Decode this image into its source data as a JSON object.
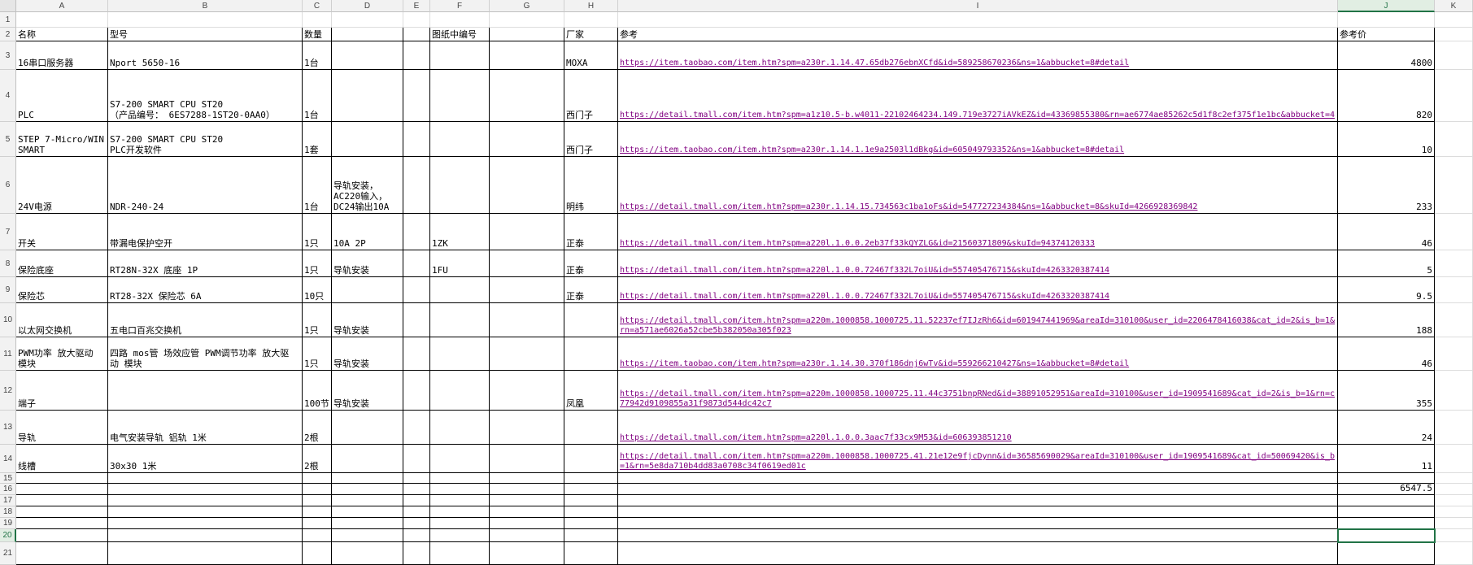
{
  "columns": [
    "A",
    "B",
    "C",
    "D",
    "E",
    "F",
    "G",
    "H",
    "I",
    "J",
    "K"
  ],
  "selected_column": "J",
  "selected_row": "20",
  "rows": [
    "1",
    "2",
    "3",
    "4",
    "5",
    "6",
    "7",
    "8",
    "9",
    "10",
    "11",
    "12",
    "13",
    "14",
    "15",
    "16",
    "17",
    "18",
    "19",
    "20",
    "21"
  ],
  "header_row": {
    "name": "名称",
    "model": "型号",
    "qty": "数量",
    "drawing_no": "图纸中编号",
    "vendor": "厂家",
    "reference": "参考",
    "ref_price": "参考价"
  },
  "items": [
    {
      "name": "16串口服务器",
      "model": "Nport 5650-16",
      "qty": "1台",
      "note": "",
      "code": "",
      "vendor": "MOXA",
      "link": "https://item.taobao.com/item.htm?spm=a230r.1.14.47.65db276ebnXCfd&id=589258670236&ns=1&abbucket=8#detail",
      "price": "4800"
    },
    {
      "name": "PLC",
      "model": "S7-200 SMART CPU ST20\n（产品编号： 6ES7288-1ST20-0AA0）",
      "qty": "1台",
      "note": "",
      "code": "",
      "vendor": "西门子",
      "link": "https://detail.tmall.com/item.htm?spm=a1z10.5-b.w4011-22102464234.149.719e3727iAVkEZ&id=43369855380&rn=ae6774ae85262c5d1f8c2ef375f1e1bc&abbucket=4",
      "price": "820"
    },
    {
      "name": "STEP 7-Micro/WIN\nSMART",
      "model": "S7-200 SMART CPU ST20\nPLC开发软件",
      "qty": "1套",
      "note": "",
      "code": "",
      "vendor": "西门子",
      "link": "https://item.taobao.com/item.htm?spm=a230r.1.14.1.1e9a2503l1dBkg&id=605049793352&ns=1&abbucket=8#detail",
      "price": "10"
    },
    {
      "name": "24V电源",
      "model": "NDR-240-24",
      "qty": "1台",
      "note": "导轨安装，\nAC220输入，\nDC24输出10A",
      "code": "",
      "vendor": "明纬",
      "link": "https://detail.tmall.com/item.htm?spm=a230r.1.14.15.734563c1ba1oFs&id=547727234384&ns=1&abbucket=8&skuId=4266928369842",
      "price": "233"
    },
    {
      "name": "开关",
      "model": "带漏电保护空开",
      "qty": "1只",
      "note": "10A 2P",
      "code": "1ZK",
      "vendor": "正泰",
      "link": "https://detail.tmall.com/item.htm?spm=a220l.1.0.0.2eb37f33kQYZLG&id=21560371809&skuId=94374120333",
      "price": "46"
    },
    {
      "name": "保险底座",
      "model": "RT28N-32X 底座 1P",
      "qty": "1只",
      "note": "导轨安装",
      "code": "1FU",
      "vendor": "正泰",
      "link": "https://detail.tmall.com/item.htm?spm=a220l.1.0.0.72467f332L7oiU&id=557405476715&skuId=4263320387414",
      "price": "5"
    },
    {
      "name": "保险芯",
      "model": "RT28-32X 保险芯 6A",
      "qty": "10只",
      "note": "",
      "code": "",
      "vendor": "正泰",
      "link": "https://detail.tmall.com/item.htm?spm=a220l.1.0.0.72467f332L7oiU&id=557405476715&skuId=4263320387414",
      "price": "9.5"
    },
    {
      "name": "以太网交换机",
      "model": "五电口百兆交换机",
      "qty": "1只",
      "note": "导轨安装",
      "code": "",
      "vendor": "",
      "link": "https://detail.tmall.com/item.htm?spm=a220m.1000858.1000725.11.52237ef7IJzRh6&id=601947441969&areaId=310100&user_id=2206478416038&cat_id=2&is_b=1&rn=a571ae6026a52cbe5b382050a305f023",
      "price": "188"
    },
    {
      "name": "PWM功率 放大驱动\n模块",
      "model": "四路 mos管 场效应管 PWM调节功率 放大驱\n动 模块",
      "qty": "1只",
      "note": "导轨安装",
      "code": "",
      "vendor": "",
      "link": "https://item.taobao.com/item.htm?spm=a230r.1.14.30.370f186dnj6wTv&id=559266210427&ns=1&abbucket=8#detail",
      "price": "46"
    },
    {
      "name": "端子",
      "model": "",
      "qty": "100节",
      "note": "导轨安装",
      "code": "",
      "vendor": "凤凰",
      "link": "https://detail.tmall.com/item.htm?spm=a220m.1000858.1000725.11.44c3751bnpRNed&id=38891052951&areaId=310100&user_id=1909541689&cat_id=2&is_b=1&rn=c77942d9109855a31f9873d544dc42c7",
      "price": "355"
    },
    {
      "name": "导轨",
      "model": "电气安装导轨 铝轨 1米",
      "qty": "2根",
      "note": "",
      "code": "",
      "vendor": "",
      "link": "https://detail.tmall.com/item.htm?spm=a220l.1.0.0.3aac7f33cx9M53&id=606393851210",
      "price": "24"
    },
    {
      "name": "线槽",
      "model": "30x30 1米",
      "qty": "2根",
      "note": "",
      "code": "",
      "vendor": "",
      "link": "https://detail.tmall.com/item.htm?spm=a220m.1000858.1000725.41.21e12e9fjcDynn&id=36585690029&areaId=310100&user_id=1909541689&cat_id=50069420&is_b=1&rn=5e8da710b4dd83a0708c34f0619ed01c",
      "price": "11"
    }
  ],
  "total": "6547.5"
}
